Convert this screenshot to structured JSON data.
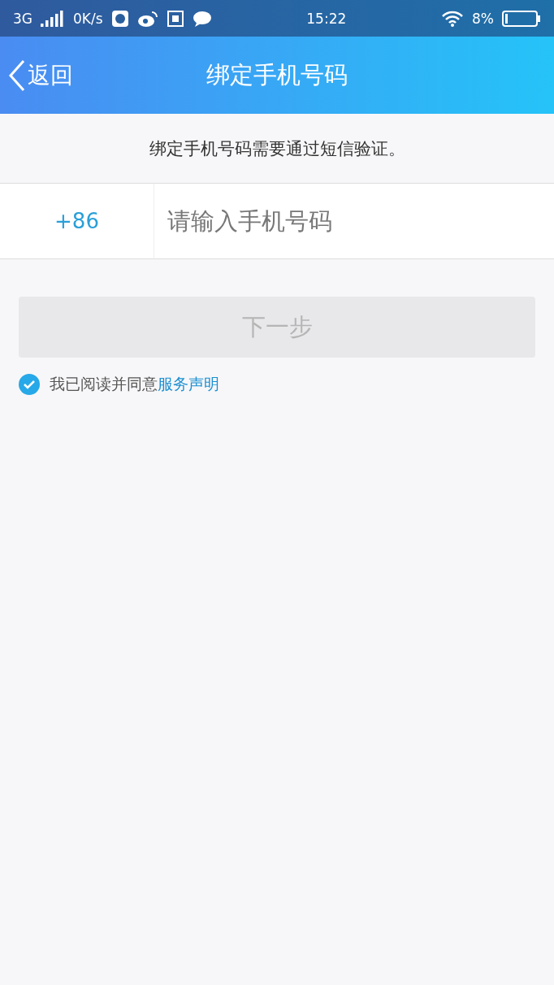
{
  "status_bar": {
    "network": "3G",
    "speed": "0K/s",
    "time": "15:22",
    "battery": "8%"
  },
  "nav_bar": {
    "back_label": "返回",
    "title": "绑定手机号码"
  },
  "notice": "绑定手机号码需要通过短信验证。",
  "phone_field": {
    "country_code": "+86",
    "placeholder": "请输入手机号码"
  },
  "next_button": {
    "label": "下一步",
    "disabled": true
  },
  "agreement": {
    "checked": true,
    "text": "我已阅读并同意",
    "link": "服务声明"
  }
}
